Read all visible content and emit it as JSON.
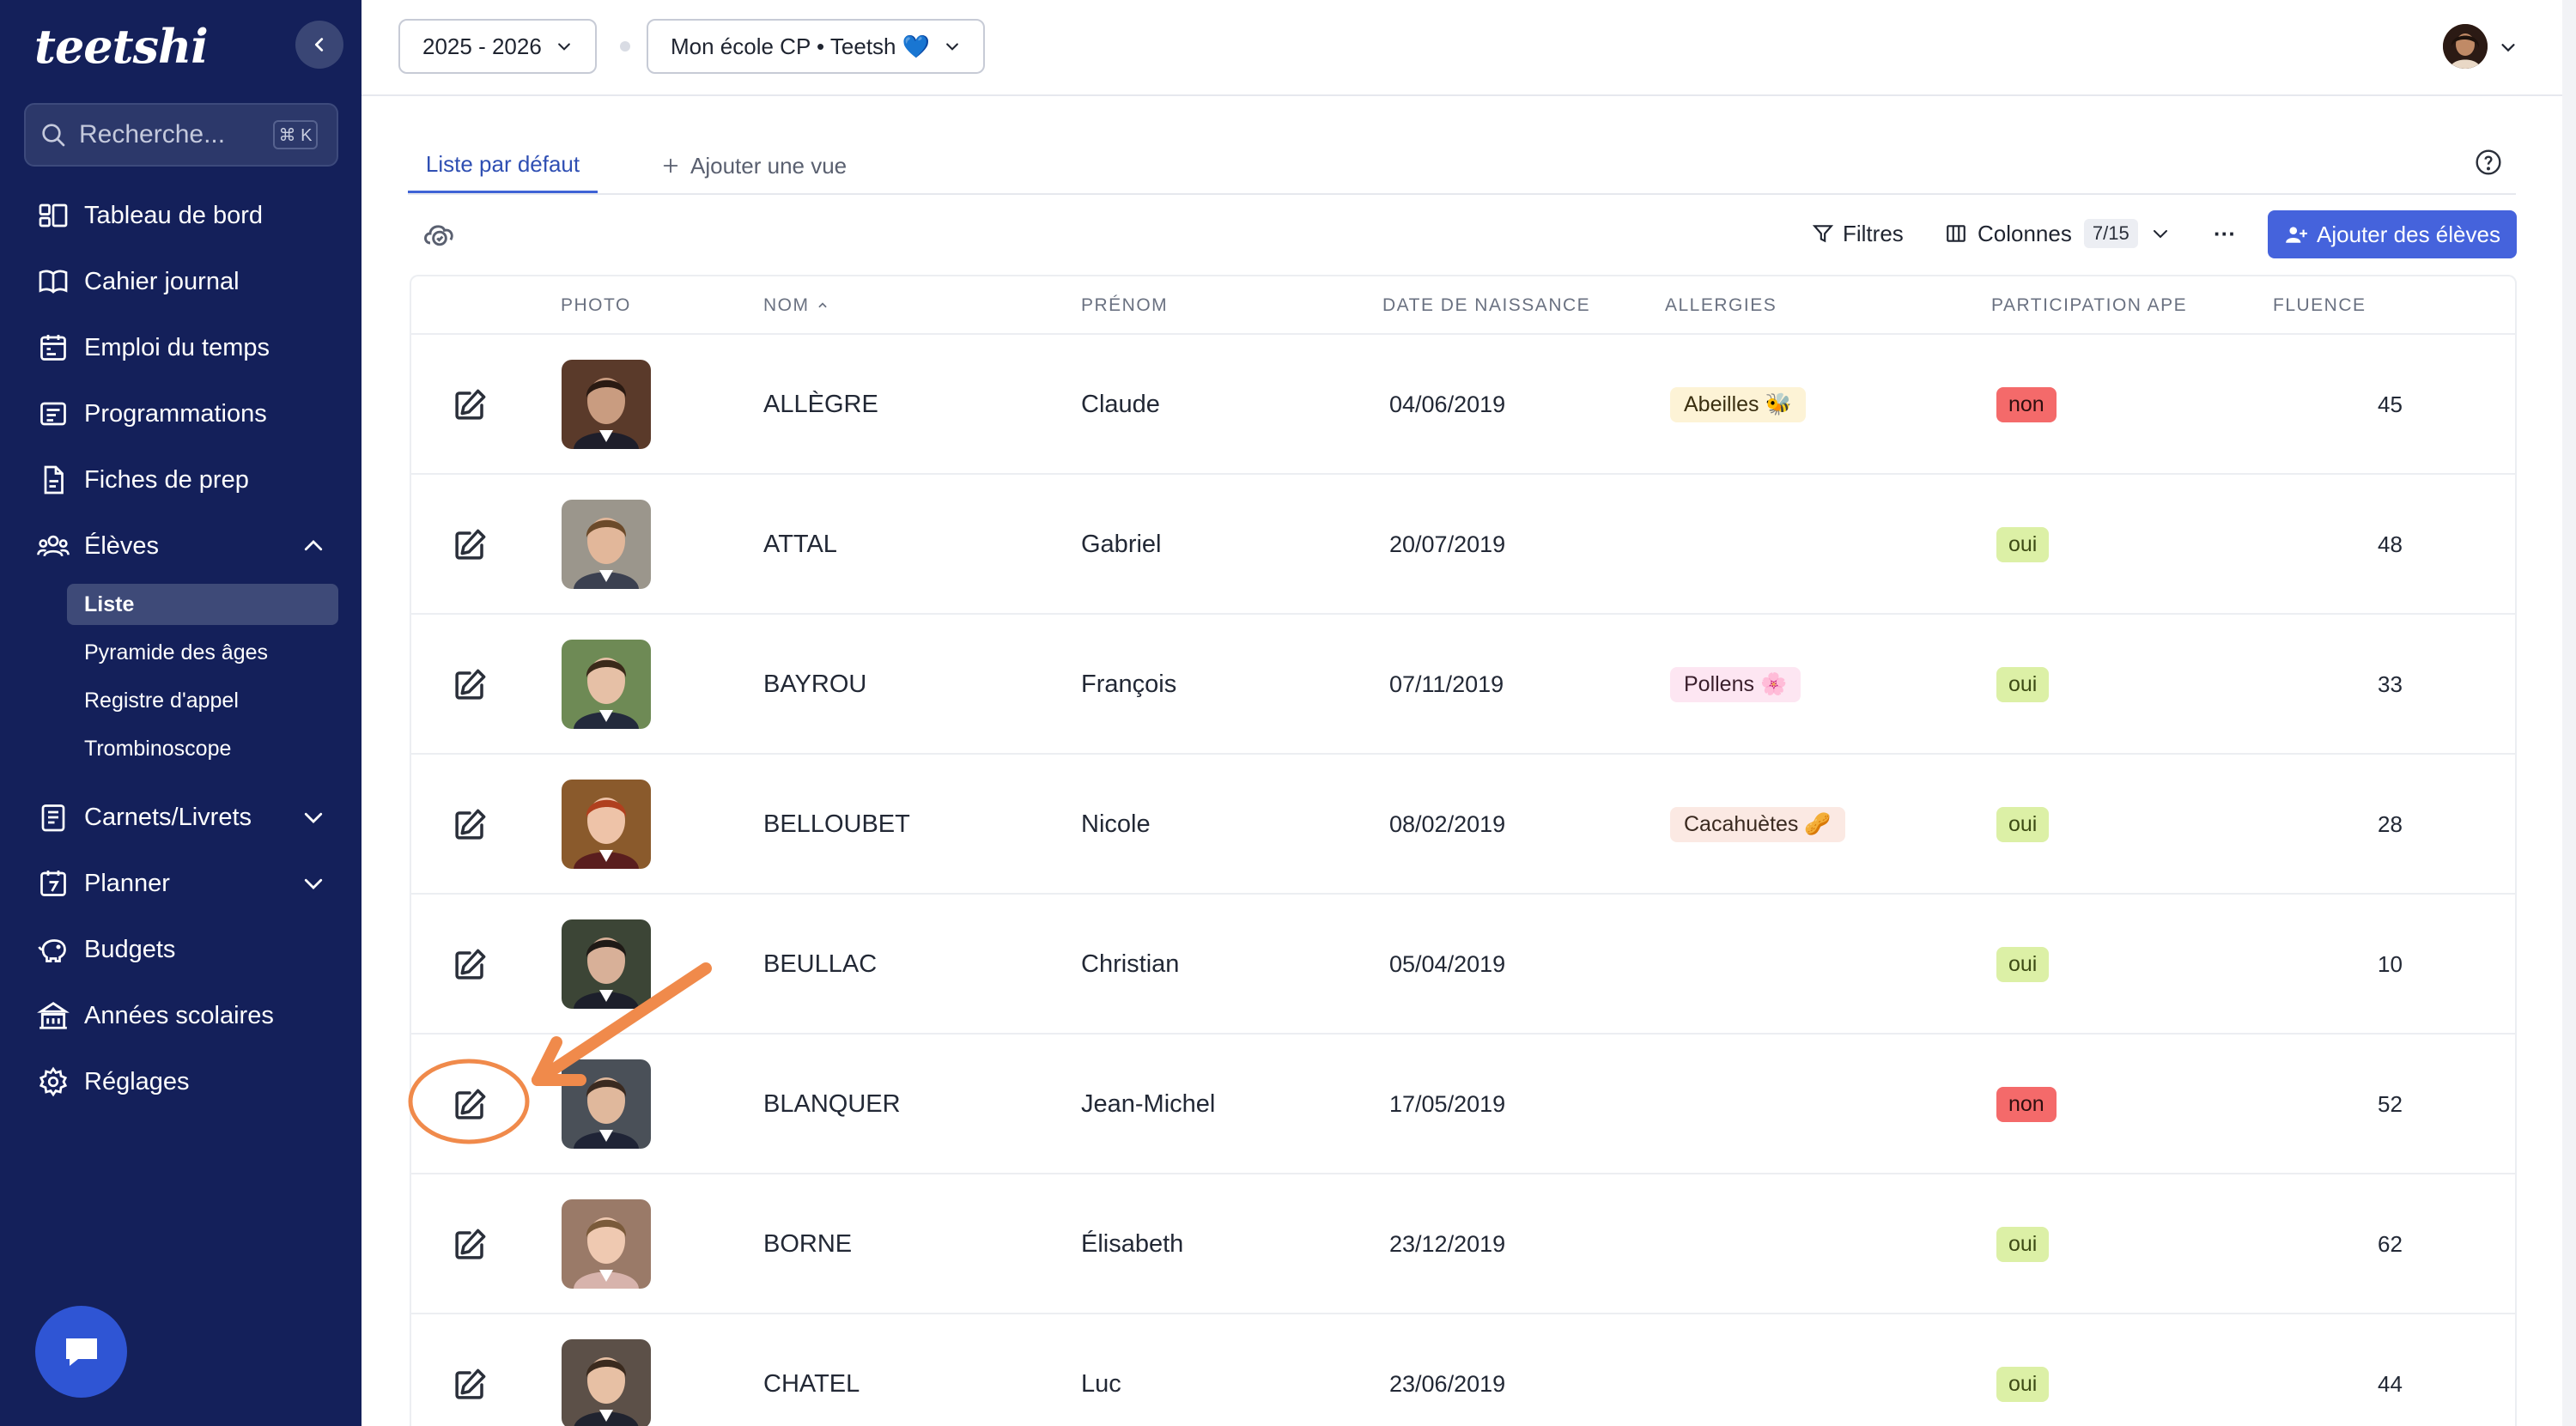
{
  "sidebar": {
    "logo": "teetshi",
    "search_placeholder": "Recherche...",
    "search_shortcut": "⌘ K",
    "items": [
      {
        "label": "Tableau de bord",
        "icon": "dashboard-icon"
      },
      {
        "label": "Cahier journal",
        "icon": "book-icon"
      },
      {
        "label": "Emploi du temps",
        "icon": "calendar-icon"
      },
      {
        "label": "Programmations",
        "icon": "list-icon"
      },
      {
        "label": "Fiches de prep",
        "icon": "document-icon"
      },
      {
        "label": "Élèves",
        "icon": "users-icon"
      },
      {
        "label": "Carnets/Livrets",
        "icon": "notebook-icon"
      },
      {
        "label": "Planner",
        "icon": "planner-icon"
      },
      {
        "label": "Budgets",
        "icon": "piggy-bank-icon"
      },
      {
        "label": "Années scolaires",
        "icon": "school-icon"
      },
      {
        "label": "Réglages",
        "icon": "gear-icon"
      }
    ],
    "sub_items": [
      {
        "label": "Liste",
        "active": true
      },
      {
        "label": "Pyramide des âges"
      },
      {
        "label": "Registre d'appel"
      },
      {
        "label": "Trombinoscope"
      }
    ]
  },
  "header": {
    "year_select": "2025 - 2026",
    "class_select": "Mon école CP • Teetsh 💙"
  },
  "tabs": {
    "active": "Liste par défaut",
    "add": "Ajouter une vue"
  },
  "toolbar": {
    "filters": "Filtres",
    "columns": "Colonnes",
    "columns_count": "7/15",
    "more": "···",
    "add_students": "Ajouter des élèves"
  },
  "table": {
    "columns": [
      "PHOTO",
      "NOM",
      "PRÉNOM",
      "DATE DE NAISSANCE",
      "ALLERGIES",
      "PARTICIPATION APE",
      "FLUENCE"
    ],
    "rows": [
      {
        "nom": "ALLÈGRE",
        "prenom": "Claude",
        "date": "04/06/2019",
        "allergie": "Abeilles 🐝",
        "allergie_type": "allergy",
        "ape": "non",
        "fluence": "45"
      },
      {
        "nom": "ATTAL",
        "prenom": "Gabriel",
        "date": "20/07/2019",
        "allergie": "",
        "allergie_type": "",
        "ape": "oui",
        "fluence": "48"
      },
      {
        "nom": "BAYROU",
        "prenom": "François",
        "date": "07/11/2019",
        "allergie": "Pollens 🌸",
        "allergie_type": "pollen",
        "ape": "oui",
        "fluence": "33"
      },
      {
        "nom": "BELLOUBET",
        "prenom": "Nicole",
        "date": "08/02/2019",
        "allergie": "Cacahuètes 🥜",
        "allergie_type": "caca",
        "ape": "oui",
        "fluence": "28"
      },
      {
        "nom": "BEULLAC",
        "prenom": "Christian",
        "date": "05/04/2019",
        "allergie": "",
        "allergie_type": "",
        "ape": "oui",
        "fluence": "10"
      },
      {
        "nom": "BLANQUER",
        "prenom": "Jean-Michel",
        "date": "17/05/2019",
        "allergie": "",
        "allergie_type": "",
        "ape": "non",
        "fluence": "52"
      },
      {
        "nom": "BORNE",
        "prenom": "Élisabeth",
        "date": "23/12/2019",
        "allergie": "",
        "allergie_type": "",
        "ape": "oui",
        "fluence": "62"
      },
      {
        "nom": "CHATEL",
        "prenom": "Luc",
        "date": "23/06/2019",
        "allergie": "",
        "allergie_type": "",
        "ape": "oui",
        "fluence": "44"
      }
    ]
  },
  "colors": {
    "sidebar_bg": "#14205a",
    "accent": "#4563dc",
    "annotation": "#f08a4b"
  }
}
